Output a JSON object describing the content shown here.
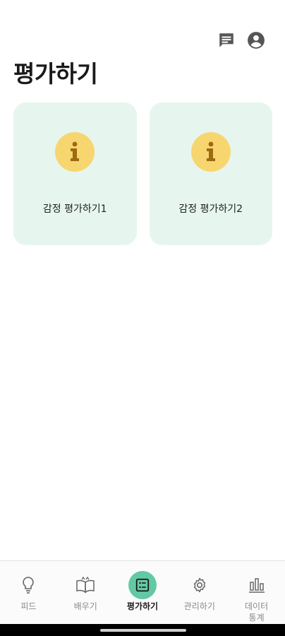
{
  "header": {
    "title": "평가하기",
    "actions": [
      {
        "icon": "chat-icon"
      },
      {
        "icon": "account-icon"
      }
    ]
  },
  "cards": [
    {
      "label": "감정 평가하기1",
      "icon": "info-icon"
    },
    {
      "label": "감정 평가하기2",
      "icon": "info-icon"
    }
  ],
  "bottom_nav": {
    "items": [
      {
        "label": "피드",
        "icon": "lightbulb-icon",
        "active": false
      },
      {
        "label": "배우기",
        "icon": "open-book-icon",
        "active": false
      },
      {
        "label": "평가하기",
        "icon": "list-alt-icon",
        "active": true
      },
      {
        "label": "관리하기",
        "icon": "gear-icon",
        "active": false
      },
      {
        "label": "데이터\n통계",
        "icon": "bar-chart-icon",
        "active": false
      }
    ]
  },
  "colors": {
    "card_bg": "#e6f6ef",
    "info_circle": "#f8d66f",
    "info_glyph": "#9b6a12",
    "nav_active": "#63c9a4"
  }
}
